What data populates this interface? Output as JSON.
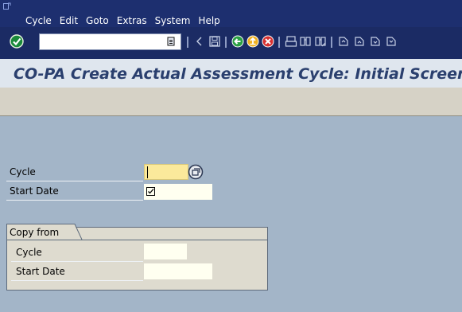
{
  "menubar": {
    "items": [
      "Cycle",
      "Edit",
      "Goto",
      "Extras",
      "System",
      "Help"
    ]
  },
  "toolbar": {
    "command_value": "",
    "icons": [
      "enter-icon",
      "command-field-dropdown-icon",
      "back-nav-icon",
      "save-icon",
      "back-icon",
      "exit-icon",
      "cancel-icon",
      "print-icon",
      "find-icon",
      "find-next-icon",
      "first-page-icon",
      "previous-page-icon",
      "next-page-icon",
      "last-page-icon"
    ]
  },
  "title": "CO-PA Create Actual Assessment Cycle: Initial Screen",
  "form": {
    "cycle_label": "Cycle",
    "start_date_label": "Start Date",
    "cycle_value": "",
    "start_date_checked": true
  },
  "copy_from": {
    "tab_label": "Copy from",
    "cycle_label": "Cycle",
    "start_date_label": "Start Date",
    "cycle_value": "",
    "start_date_value": ""
  },
  "colors": {
    "menubar_bg": "#1d2f6f",
    "title_color": "#2a3f6e",
    "content_bg": "#a3b5c8",
    "required_field": "#fbe99b",
    "input_bg": "#fffff0"
  }
}
